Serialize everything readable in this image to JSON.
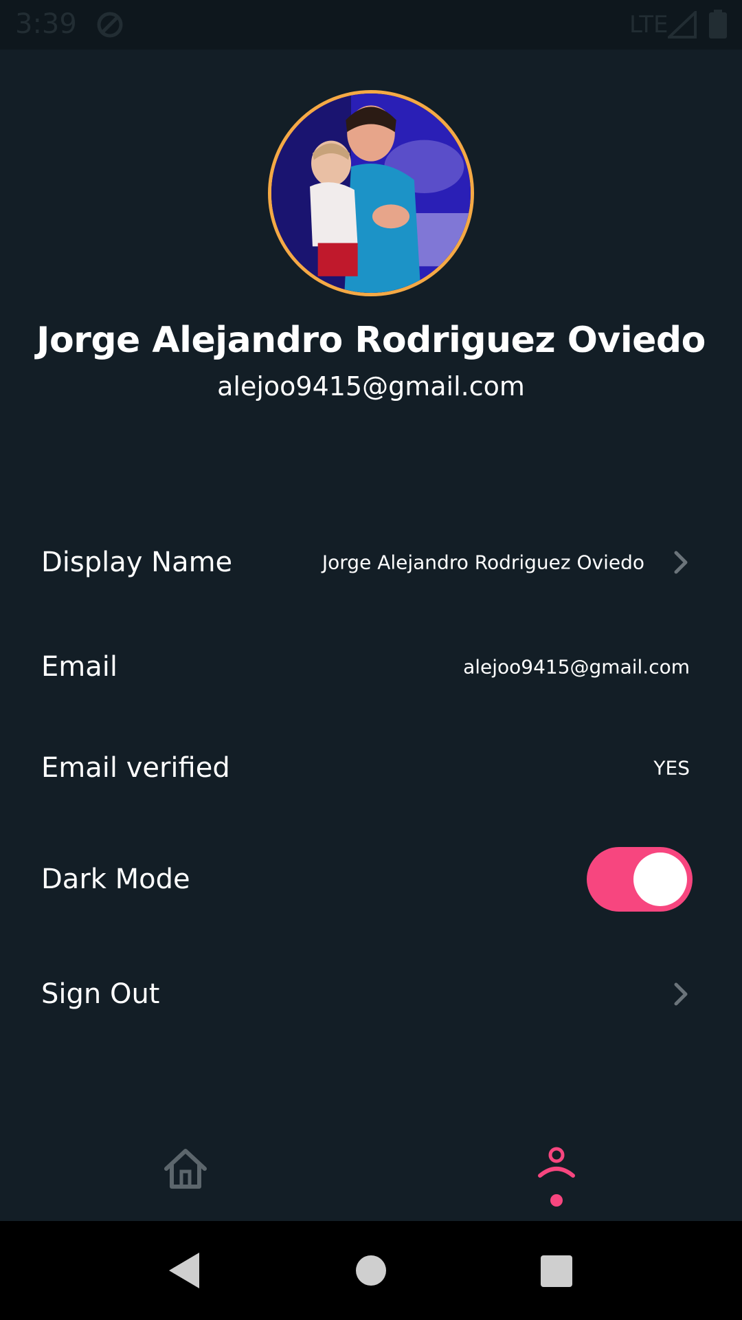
{
  "status_bar": {
    "time": "3:39",
    "network": "LTE",
    "icons": [
      "sync-icon",
      "signal-icon",
      "battery-icon"
    ]
  },
  "profile": {
    "name": "Jorge Alejandro Rodriguez Oviedo",
    "email": "alejoo9415@gmail.com",
    "avatar_border_color": "#f5a945"
  },
  "settings": {
    "display_name": {
      "label": "Display Name",
      "value": "Jorge Alejandro Rodriguez Oviedo"
    },
    "email": {
      "label": "Email",
      "value": "alejoo9415@gmail.com"
    },
    "email_verified": {
      "label": "Email verified",
      "value": "YES"
    },
    "dark_mode": {
      "label": "Dark Mode",
      "enabled": true
    },
    "sign_out": {
      "label": "Sign Out"
    }
  },
  "bottom_nav": {
    "items": [
      {
        "icon": "home-icon",
        "active": false
      },
      {
        "icon": "profile-icon",
        "active": true
      }
    ]
  },
  "colors": {
    "background": "#131e26",
    "accent": "#f7467f",
    "text": "#ffffff",
    "muted_icon": "#6b747a"
  }
}
